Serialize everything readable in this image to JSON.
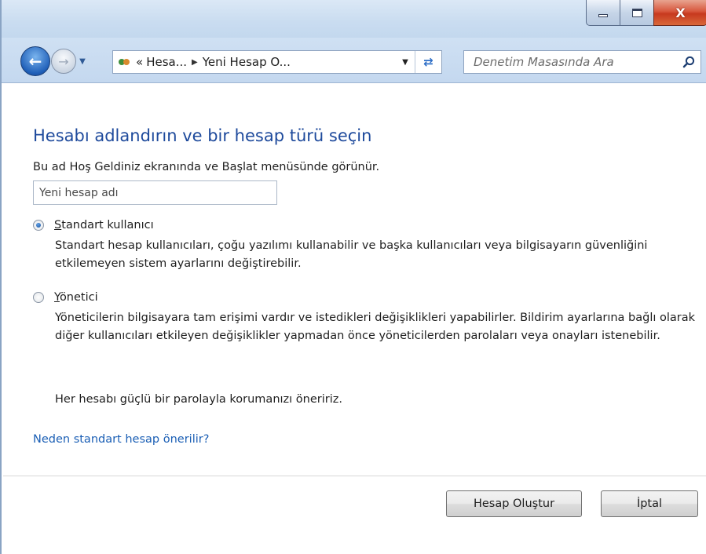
{
  "window": {
    "controls": {
      "minimize": "minimize",
      "maximize": "maximize",
      "close": "X"
    }
  },
  "navbar": {
    "address": {
      "prefix": "«",
      "crumbs": [
        "Hesa...",
        "Yeni Hesap O..."
      ]
    },
    "search": {
      "placeholder": "Denetim Masasında Ara"
    }
  },
  "main": {
    "title": "Hesabı adlandırın ve bir hesap türü seçin",
    "subtitle": "Bu ad Hoş Geldiniz ekranında ve Başlat menüsünde görünür.",
    "name_input": {
      "placeholder": "Yeni hesap adı",
      "value": ""
    },
    "options": [
      {
        "accel": "S",
        "label_rest": "tandart kullanıcı",
        "selected": true,
        "description": "Standart hesap kullanıcıları, çoğu yazılımı kullanabilir ve başka kullanıcıları veya bilgisayarın güvenliğini etkilemeyen sistem ayarlarını değiştirebilir."
      },
      {
        "accel": "Y",
        "label_rest": "önetici",
        "selected": false,
        "description": "Yöneticilerin bilgisayara tam erişimi vardır ve istedikleri değişiklikleri yapabilirler. Bildirim ayarlarına bağlı olarak diğer kullanıcıları etkileyen değişiklikler yapmadan önce yöneticilerden parolaları veya onayları istenebilir."
      }
    ],
    "recommendation": "Her hesabı güçlü bir parolayla korumanızı öneririz.",
    "help_link": "Neden standart hesap önerilir?"
  },
  "footer": {
    "create_label": "Hesap Oluştur",
    "cancel_label": "İptal"
  },
  "colors": {
    "heading": "#1e4a9c",
    "link": "#1b5fb5",
    "frame": "#c4d8ef"
  }
}
